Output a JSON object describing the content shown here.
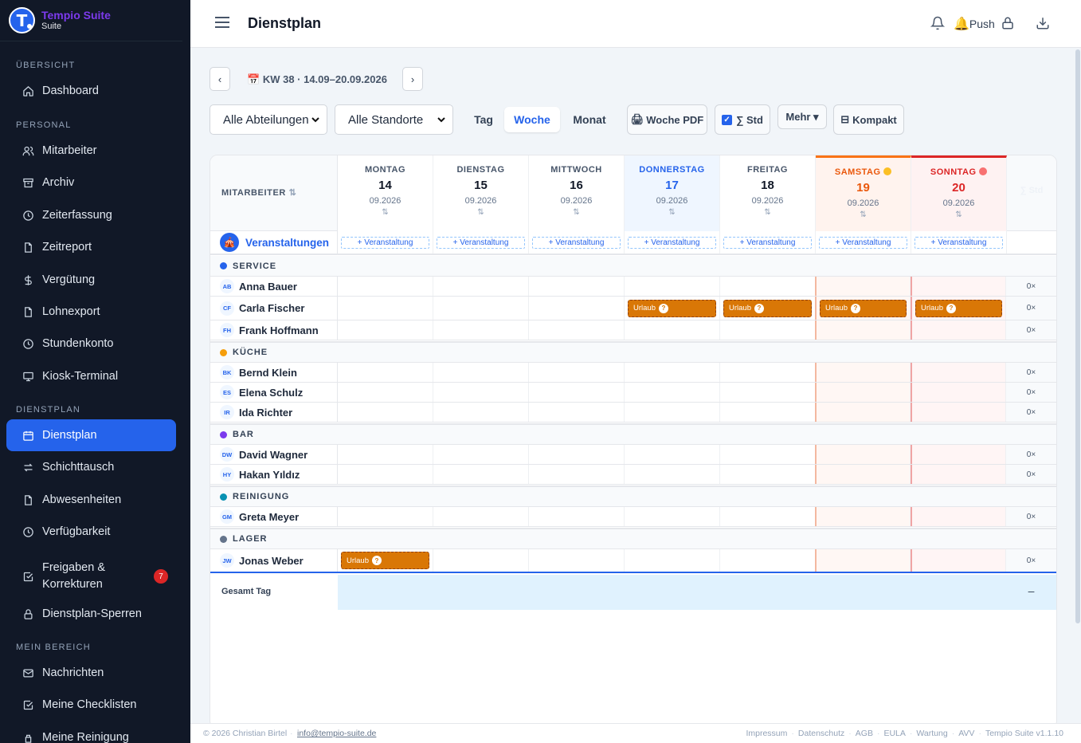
{
  "app": {
    "name": "Tempio Suite",
    "sub": "Suite"
  },
  "sidebar": {
    "sections": [
      "ÜBERSICHT",
      "PERSONAL",
      "DIENSTPLAN",
      "MEIN BEREICH"
    ],
    "items": [
      {
        "label": "Dashboard",
        "icon": "home-icon"
      },
      {
        "label": "Mitarbeiter",
        "icon": "users-icon"
      },
      {
        "label": "Archiv",
        "icon": "archive-icon"
      },
      {
        "label": "Zeiterfassung",
        "icon": "clock-icon"
      },
      {
        "label": "Zeitreport",
        "icon": "file-icon"
      },
      {
        "label": "Vergütung",
        "icon": "dollar-icon"
      },
      {
        "label": "Lohnexport",
        "icon": "file-icon"
      },
      {
        "label": "Stundenkonto",
        "icon": "clock-icon"
      },
      {
        "label": "Kiosk-Terminal",
        "icon": "monitor-icon"
      },
      {
        "label": "Dienstplan",
        "icon": "calendar-icon"
      },
      {
        "label": "Schichttausch",
        "icon": "swap-icon"
      },
      {
        "label": "Abwesenheiten",
        "icon": "file-icon"
      },
      {
        "label": "Verfügbarkeit",
        "icon": "clock-icon"
      },
      {
        "label": "Freigaben &",
        "label2": "Korrekturen",
        "icon": "check-square-icon",
        "badge": "7"
      },
      {
        "label": "Dienstplan-Sperren",
        "icon": "lock-icon"
      },
      {
        "label": "Nachrichten",
        "icon": "mail-icon"
      },
      {
        "label": "Meine Checklisten",
        "icon": "check-square-icon"
      },
      {
        "label": "Meine Reinigung",
        "icon": "spray-icon"
      }
    ]
  },
  "header": {
    "title": "Dienstplan",
    "push_label": "Push"
  },
  "toolbar": {
    "week_label": "KW 38 · 14.09–20.09.2026",
    "prev": "‹",
    "next": "›",
    "dept_select": "Alle Abteilungen",
    "loc_select": "Alle Standorte",
    "views": [
      "Tag",
      "Woche",
      "Monat"
    ],
    "active_view": "Woche",
    "pdf_label": "Woche PDF",
    "std_label": "∑ Std",
    "std_checked": true,
    "more_label": "Mehr ▾",
    "compact_label": "Kompakt"
  },
  "grid": {
    "employee_header": "MITARBEITER",
    "days": [
      {
        "name": "MONTAG",
        "day": "14",
        "month": "09.2026"
      },
      {
        "name": "DIENSTAG",
        "day": "15",
        "month": "09.2026"
      },
      {
        "name": "MITTWOCH",
        "day": "16",
        "month": "09.2026"
      },
      {
        "name": "DONNERSTAG",
        "day": "17",
        "month": "09.2026",
        "today": true
      },
      {
        "name": "FREITAG",
        "day": "18",
        "month": "09.2026"
      },
      {
        "name": "SAMSTAG",
        "day": "19",
        "month": "09.2026",
        "weekend": "sat"
      },
      {
        "name": "SONNTAG",
        "day": "20",
        "month": "09.2026",
        "weekend": "sun"
      }
    ],
    "sum_header": "∑ Std",
    "events_label": "Veranstaltungen",
    "add_event_label": "+ Veranstaltung",
    "groups": [
      {
        "name": "SERVICE",
        "color": "#2563eb",
        "employees": [
          {
            "initials": "AB",
            "name": "Anna Bauer",
            "count": "0×",
            "absences": []
          },
          {
            "initials": "CF",
            "name": "Carla Fischer",
            "count": "0×",
            "absences": [
              3,
              4,
              5,
              6
            ]
          },
          {
            "initials": "FH",
            "name": "Frank Hoffmann",
            "count": "0×",
            "absences": []
          }
        ]
      },
      {
        "name": "KÜCHE",
        "color": "#f59e0b",
        "employees": [
          {
            "initials": "BK",
            "name": "Bernd Klein",
            "count": "0×",
            "absences": []
          },
          {
            "initials": "ES",
            "name": "Elena Schulz",
            "count": "0×",
            "absences": []
          },
          {
            "initials": "IR",
            "name": "Ida Richter",
            "count": "0×",
            "absences": []
          }
        ]
      },
      {
        "name": "BAR",
        "color": "#7c3aed",
        "employees": [
          {
            "initials": "DW",
            "name": "David Wagner",
            "count": "0×",
            "absences": []
          },
          {
            "initials": "HY",
            "name": "Hakan Yıldız",
            "count": "0×",
            "absences": []
          }
        ]
      },
      {
        "name": "REINIGUNG",
        "color": "#0891b2",
        "employees": [
          {
            "initials": "GM",
            "name": "Greta Meyer",
            "count": "0×",
            "absences": []
          }
        ]
      },
      {
        "name": "LAGER",
        "color": "#64748b",
        "employees": [
          {
            "initials": "JW",
            "name": "Jonas Weber",
            "count": "0×",
            "absences": [
              0
            ]
          }
        ]
      }
    ],
    "absence_label": "Urlaub",
    "absence_help": "?",
    "total_label": "Gesamt Tag",
    "total_value": "–"
  },
  "footer": {
    "copyright": "© 2026 Christian Birtel",
    "email": "info@tempio-suite.de",
    "links": [
      "Impressum",
      "Datenschutz",
      "AGB",
      "EULA",
      "Wartung",
      "AVV",
      "Tempio Suite v1.1.10"
    ]
  },
  "colors": {
    "accent": "#2563eb",
    "sidebar_bg": "#111827",
    "absence": "#d97706",
    "saturday": "#ea580c",
    "sunday": "#dc2626"
  }
}
